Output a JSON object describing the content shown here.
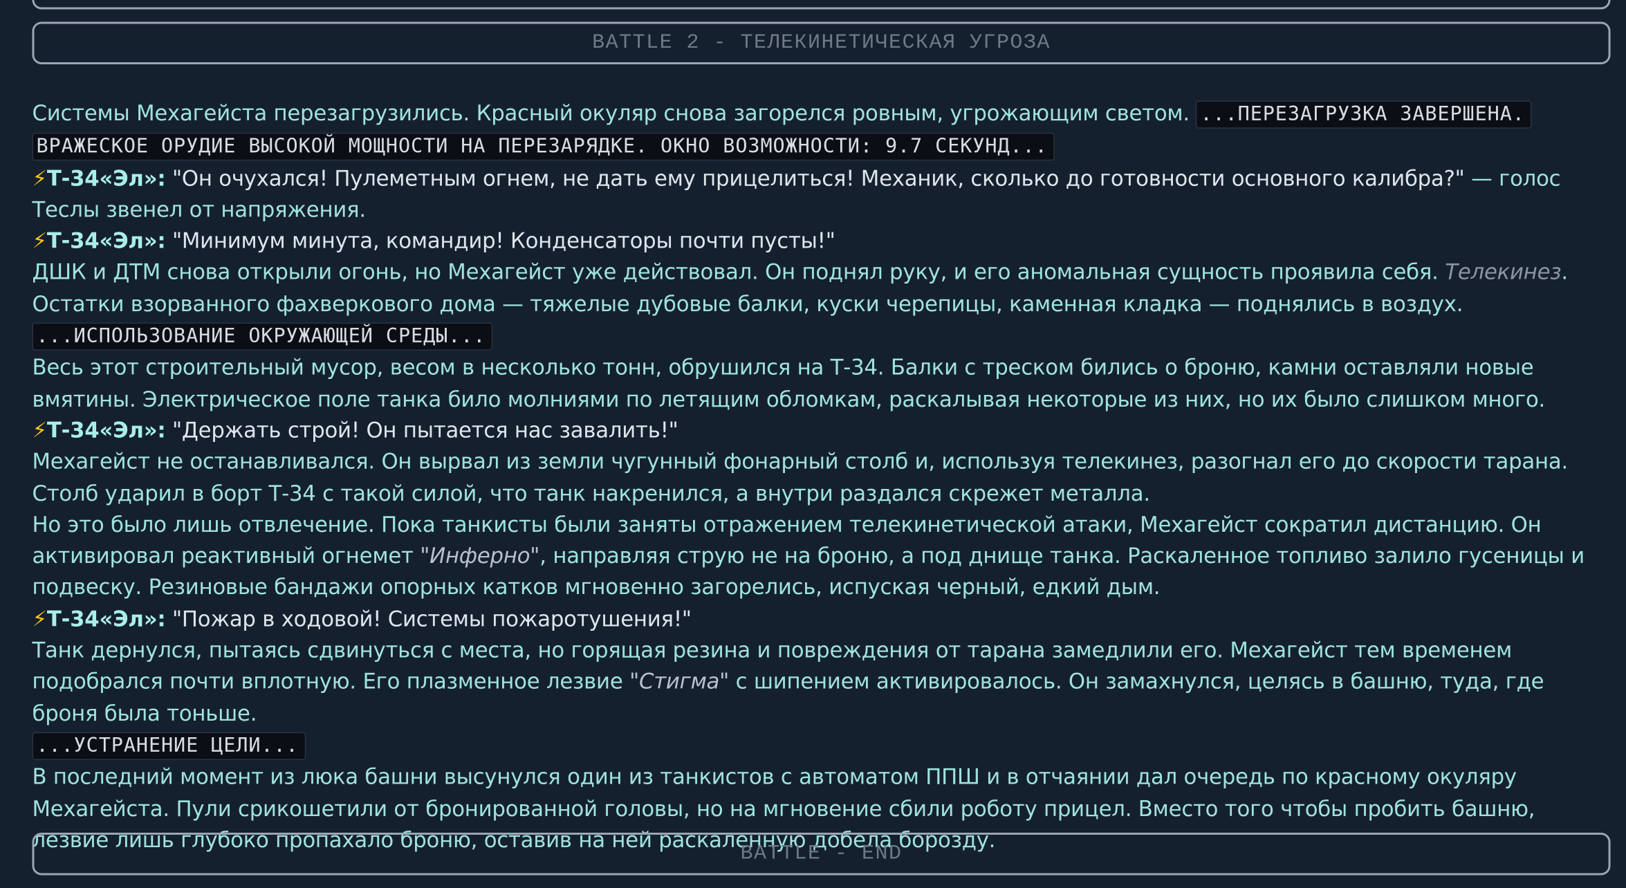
{
  "banners": {
    "battle_start": "BATTLE 2 - ТЕЛЕКИНЕТИЧЕСКАЯ УГРОЗА",
    "battle_end": "BATTLE - END"
  },
  "speaker": {
    "icon": "⚡",
    "name": "Т-34«Эл»:"
  },
  "story": {
    "p1_text": "Системы Мехагейста перезагрузились. Красный окуляр снова загорелся ровным, угрожающим светом. ",
    "p1_sys": "...ПЕРЕЗАГРУЗКА ЗАВЕРШЕНА. ВРАЖЕСКОЕ ОРУДИЕ ВЫСОКОЙ МОЩНОСТИ НА ПЕРЕЗАРЯДКЕ. ОКНО ВОЗМОЖНОСТИ: 9.7 СЕКУНД...",
    "d1_quote": "\"Он очухался! Пулеметным огнем, не дать ему прицелиться! Механик, сколько до готовности основного калибра?\"",
    "d1_tail": " — голос Теслы звенел от напряжения.",
    "d2_quote": "\"Минимум минута, командир! Конденсаторы почти пусты!\"",
    "p2_text": "ДШК и ДТМ снова открыли огонь, но Мехагейст уже действовал. Он поднял руку, и его аномальная сущность проявила себя. ",
    "p2_em": "Телекинез",
    "p2_end": ".",
    "p3_text": "Остатки взорванного фахверкового дома — тяжелые дубовые балки, куски черепицы, каменная кладка — поднялись в воздух.",
    "sys2": "...ИСПОЛЬЗОВАНИЕ ОКРУЖАЮЩЕЙ СРЕДЫ...",
    "p4_text": "Весь этот строительный мусор, весом в несколько тонн, обрушился на Т-34. Балки с треском бились о броню, камни оставляли новые вмятины. Электрическое поле танка било молниями по летящим обломкам, раскалывая некоторые из них, но их было слишком много.",
    "d3_quote": "\"Держать строй! Он пытается нас завалить!\"",
    "p5_text": "Мехагейст не останавливался. Он вырвал из земли чугунный фонарный столб и, используя телекинез, разогнал его до скорости тарана. Столб ударил в борт Т-34 с такой силой, что танк накренился, а внутри раздался скрежет металла.",
    "p6_a": "Но это было лишь отвлечение. Пока танкисты были заняты отражением телекинетической атаки, Мехагейст сократил дистанцию. Он активировал реактивный огнемет ",
    "p6_em": "\"Инферно\"",
    "p6_b": ", направляя струю не на броню, а под днище танка. Раскаленное топливо залило гусеницы и подвеску. Резиновые бандажи опорных катков мгновенно загорелись, испуская черный, едкий дым.",
    "d4_quote": "\"Пожар в ходовой! Системы пожаротушения!\"",
    "p7_a": "Танк дернулся, пытаясь сдвинуться с места, но горящая резина и повреждения от тарана замедлили его. Мехагейст тем временем подобрался почти вплотную. Его плазменное лезвие ",
    "p7_em": "\"Стигма\"",
    "p7_b": " с шипением активировалось. Он замахнулся, целясь в башню, туда, где броня была тоньше.",
    "sys3": "...УСТРАНЕНИЕ ЦЕЛИ...",
    "p8_text": "В последний момент из люка башни высунулся один из танкистов с автоматом ППШ и в отчаянии дал очередь по красному окуляру Мехагейста. Пули срикошетили от бронированной головы, но на мгновение сбили роботу прицел. Вместо того чтобы пробить башню, лезвие лишь глубоко пропахало броню, оставив на ней раскаленную добела борозду."
  }
}
